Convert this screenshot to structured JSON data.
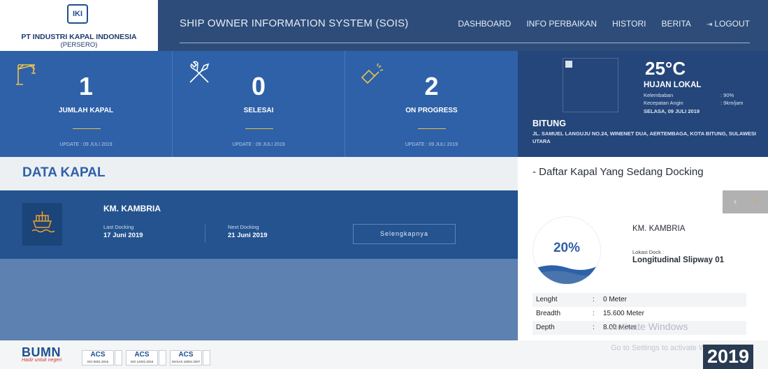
{
  "brand": {
    "logo_text": "IKI",
    "company": "PT INDUSTRI KAPAL INDONESIA",
    "company_sub": "(PERSERO)"
  },
  "header": {
    "app_title": "SHIP OWNER INFORMATION SYSTEM (SOIS)",
    "nav": {
      "dashboard": "DASHBOARD",
      "perbaikan": "INFO PERBAIKAN",
      "histori": "HISTORI",
      "berita": "BERITA",
      "logout": "LOGOUT"
    }
  },
  "stats": [
    {
      "value": "1",
      "label": "JUMLAH KAPAL",
      "update": "UPDATE : 09 JULI 2019",
      "icon": "crane-icon"
    },
    {
      "value": "0",
      "label": "SELESAI",
      "update": "UPDATE : 09 JULI 2019",
      "icon": "tools-icon"
    },
    {
      "value": "2",
      "label": "ON PROGRESS",
      "update": "UPDATE : 09 JULI 2019",
      "icon": "welding-icon"
    }
  ],
  "weather": {
    "temperature": "25°C",
    "condition": "HUJAN LOKAL",
    "humidity_label": "Kelembaban",
    "humidity_value": ": 90%",
    "wind_label": "Kecepatan Angin",
    "wind_value": ": 9km/jam",
    "date": "SELASA, 09 JULI 2019",
    "city": "BITUNG",
    "address": "JL. SAMUEL LANGUJU NO.24, WINENET DUA, AERTEMBAGA, KOTA BITUNG, SULAWESI UTARA"
  },
  "data_kapal": {
    "title": "DATA KAPAL",
    "ship_name": "KM. KAMBRIA",
    "last_docking_label": "Last Docking",
    "last_docking_value": "17 Juni 2019",
    "next_docking_label": "Next Docking",
    "next_docking_value": "21 Juni 2019",
    "more_button": "Selengkapnya"
  },
  "docking": {
    "title": "- Daftar Kapal Yang Sedang Docking",
    "progress": "20%",
    "progress_fraction": 0.2,
    "ship_name": "KM. KAMBRIA",
    "location_label": "Lokasi Dock :",
    "location_value": "Longitudinal Slipway 01",
    "specs": [
      {
        "key": "Lenght",
        "value": "0 Meter"
      },
      {
        "key": "Breadth",
        "value": "15.600 Meter"
      },
      {
        "key": "Depth",
        "value": "8.00 Meter"
      }
    ]
  },
  "footer": {
    "bumn": "BUMN",
    "bumn_tag": "Hadir untuk negeri",
    "certs": [
      {
        "name": "ACS",
        "code": "ISO 9001:2015"
      },
      {
        "name": "ACS",
        "code": "ISO 14001:2015"
      },
      {
        "name": "ACS",
        "code": "OHSAS 18001:2007"
      }
    ],
    "year": "2019",
    "copyright": "©"
  },
  "watermark": {
    "line1": "Activate Windows",
    "line2": "Go to Settings to activate Windows."
  }
}
